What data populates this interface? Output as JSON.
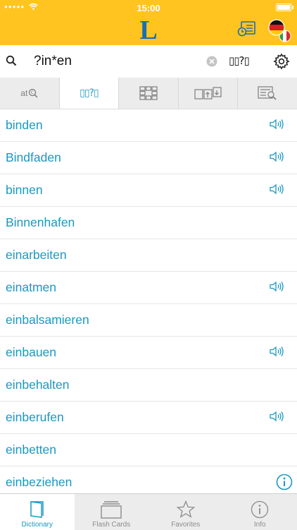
{
  "status_bar": {
    "time": "15:00"
  },
  "header": {
    "logo_text": "L"
  },
  "search": {
    "query": "?in*en",
    "wildcard_label": "▯▯?▯"
  },
  "mode_tabs": [
    {
      "label": "at",
      "name": "text-search"
    },
    {
      "label": "▯▯?▯",
      "name": "wildcard-search"
    },
    {
      "label": "",
      "name": "crossword-search"
    },
    {
      "label": "",
      "name": "anagram-search"
    },
    {
      "label": "",
      "name": "fulltext-search"
    }
  ],
  "words": [
    {
      "text": "binden",
      "audio": true
    },
    {
      "text": "Bindfaden",
      "audio": true
    },
    {
      "text": "binnen",
      "audio": true
    },
    {
      "text": "Binnenhafen",
      "audio": false
    },
    {
      "text": "einarbeiten",
      "audio": false
    },
    {
      "text": "einatmen",
      "audio": true
    },
    {
      "text": "einbalsamieren",
      "audio": false
    },
    {
      "text": "einbauen",
      "audio": true
    },
    {
      "text": "einbehalten",
      "audio": false
    },
    {
      "text": "einberufen",
      "audio": true
    },
    {
      "text": "einbetten",
      "audio": false
    },
    {
      "text": "einbeziehen",
      "audio": false,
      "info": true
    }
  ],
  "bottom_nav": [
    {
      "label": "Dictionary",
      "icon": "book-icon",
      "active": true
    },
    {
      "label": "Flash Cards",
      "icon": "cards-icon",
      "active": false
    },
    {
      "label": "Favorites",
      "icon": "star-icon",
      "active": false
    },
    {
      "label": "Info",
      "icon": "info-icon",
      "active": false
    }
  ],
  "colors": {
    "header_bg": "#ffc41f",
    "accent": "#1a98c1",
    "logo": "#1a6db3",
    "tab_bar_bg": "#ececec"
  }
}
